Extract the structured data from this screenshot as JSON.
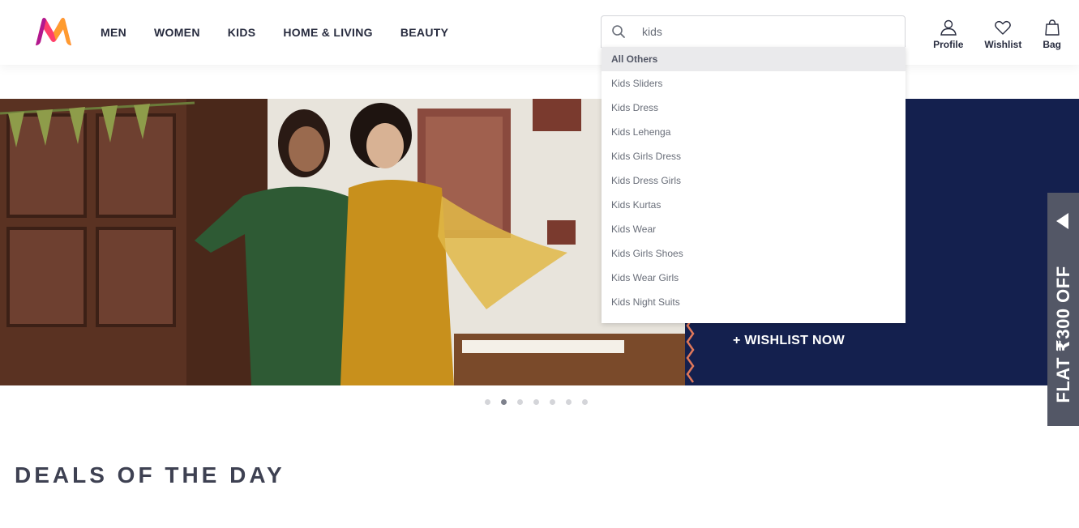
{
  "brand": {
    "logo_icon": "myntra-m-logo",
    "colors": {
      "pink": "#ff3f6c",
      "orange": "#ff9b2f",
      "purple": "#b1188f"
    }
  },
  "nav": {
    "items": [
      "MEN",
      "WOMEN",
      "KIDS",
      "HOME & LIVING",
      "BEAUTY"
    ]
  },
  "search": {
    "value": "kids",
    "icon": "search-icon"
  },
  "actions": {
    "profile": "Profile",
    "wishlist": "Wishlist",
    "bag": "Bag"
  },
  "suggestions": {
    "header": "All Others",
    "items": [
      "Kids Sliders",
      "Kids Dress",
      "Kids Lehenga",
      "Kids Girls Dress",
      "Kids Dress Girls",
      "Kids Kurtas",
      "Kids Wear",
      "Kids Girls Shoes",
      "Kids Wear Girls",
      "Kids Night Suits"
    ]
  },
  "banner": {
    "cta": "+ WISHLIST NOW",
    "bg_color": "#14204e",
    "slides": 7,
    "active_slide": 2
  },
  "side_tab": {
    "text": "FLAT ₹300 OFF"
  },
  "section": {
    "title": "DEALS OF THE DAY"
  }
}
